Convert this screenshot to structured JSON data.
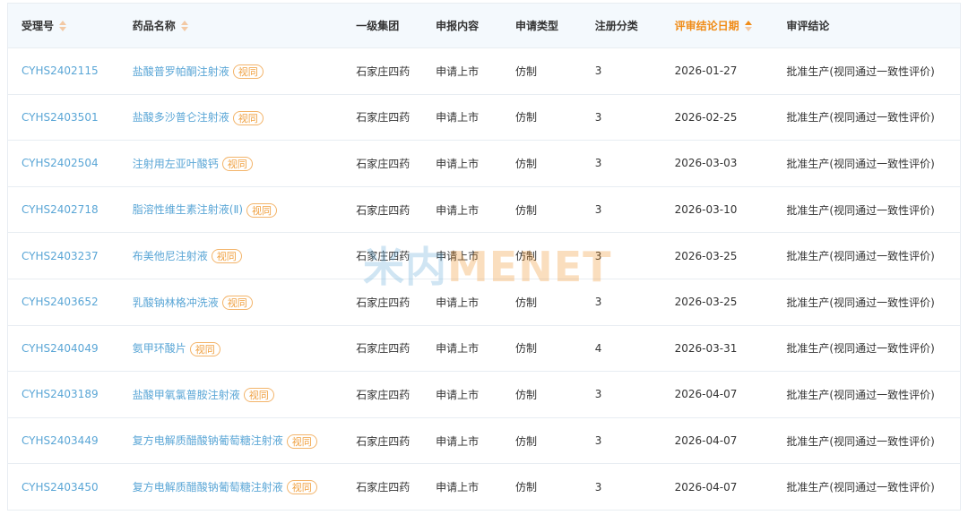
{
  "table": {
    "headers": {
      "accept_no": "受理号",
      "drug_name": "药品名称",
      "group": "一级集团",
      "content": "申报内容",
      "apply_type": "申请类型",
      "reg_class": "注册分类",
      "review_date": "评审结论日期",
      "conclusion": "审评结论"
    },
    "rows": [
      {
        "accept_no": "CYHS2402115",
        "drug_name": "盐酸普罗帕酮注射液",
        "badge": "视同",
        "group": "石家庄四药",
        "content": "申请上市",
        "apply_type": "仿制",
        "reg_class": "3",
        "review_date": "2026-01-27",
        "conclusion": "批准生产(视同通过一致性评价)"
      },
      {
        "accept_no": "CYHS2403501",
        "drug_name": "盐酸多沙普仑注射液",
        "badge": "视同",
        "group": "石家庄四药",
        "content": "申请上市",
        "apply_type": "仿制",
        "reg_class": "3",
        "review_date": "2026-02-25",
        "conclusion": "批准生产(视同通过一致性评价)"
      },
      {
        "accept_no": "CYHS2402504",
        "drug_name": "注射用左亚叶酸钙",
        "badge": "视同",
        "group": "石家庄四药",
        "content": "申请上市",
        "apply_type": "仿制",
        "reg_class": "3",
        "review_date": "2026-03-03",
        "conclusion": "批准生产(视同通过一致性评价)"
      },
      {
        "accept_no": "CYHS2402718",
        "drug_name": "脂溶性维生素注射液(Ⅱ)",
        "badge": "视同",
        "group": "石家庄四药",
        "content": "申请上市",
        "apply_type": "仿制",
        "reg_class": "3",
        "review_date": "2026-03-10",
        "conclusion": "批准生产(视同通过一致性评价)"
      },
      {
        "accept_no": "CYHS2403237",
        "drug_name": "布美他尼注射液",
        "badge": "视同",
        "group": "石家庄四药",
        "content": "申请上市",
        "apply_type": "仿制",
        "reg_class": "3",
        "review_date": "2026-03-25",
        "conclusion": "批准生产(视同通过一致性评价)"
      },
      {
        "accept_no": "CYHS2403652",
        "drug_name": "乳酸钠林格冲洗液",
        "badge": "视同",
        "group": "石家庄四药",
        "content": "申请上市",
        "apply_type": "仿制",
        "reg_class": "3",
        "review_date": "2026-03-25",
        "conclusion": "批准生产(视同通过一致性评价)"
      },
      {
        "accept_no": "CYHS2404049",
        "drug_name": "氨甲环酸片",
        "badge": "视同",
        "group": "石家庄四药",
        "content": "申请上市",
        "apply_type": "仿制",
        "reg_class": "4",
        "review_date": "2026-03-31",
        "conclusion": "批准生产(视同通过一致性评价)"
      },
      {
        "accept_no": "CYHS2403189",
        "drug_name": "盐酸甲氧氯普胺注射液",
        "badge": "视同",
        "group": "石家庄四药",
        "content": "申请上市",
        "apply_type": "仿制",
        "reg_class": "3",
        "review_date": "2026-04-07",
        "conclusion": "批准生产(视同通过一致性评价)"
      },
      {
        "accept_no": "CYHS2403449",
        "drug_name": "复方电解质醋酸钠葡萄糖注射液",
        "badge": "视同",
        "group": "石家庄四药",
        "content": "申请上市",
        "apply_type": "仿制",
        "reg_class": "3",
        "review_date": "2026-04-07",
        "conclusion": "批准生产(视同通过一致性评价)"
      },
      {
        "accept_no": "CYHS2403450",
        "drug_name": "复方电解质醋酸钠葡萄糖注射液",
        "badge": "视同",
        "group": "石家庄四药",
        "content": "申请上市",
        "apply_type": "仿制",
        "reg_class": "3",
        "review_date": "2026-04-07",
        "conclusion": "批准生产(视同通过一致性评价)"
      }
    ]
  },
  "watermark": {
    "part_a": "米内",
    "part_b": "MENET"
  },
  "colors": {
    "link": "#5aa6d6",
    "accent": "#f08c18",
    "header_bg": "#f4f9fd",
    "border": "#e8edf2"
  }
}
